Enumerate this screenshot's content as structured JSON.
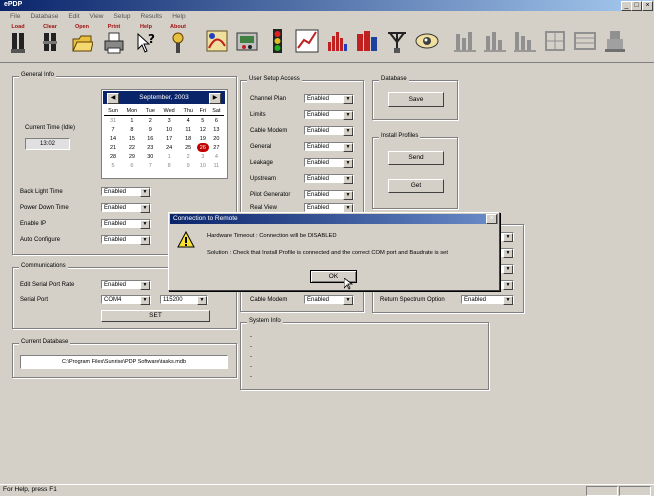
{
  "window": {
    "title": "ePDP",
    "controls": [
      "_",
      "□",
      "×"
    ]
  },
  "menu": [
    "File",
    "Database",
    "Edit",
    "View",
    "Setup",
    "Results",
    "Help"
  ],
  "toolbar": {
    "buttons": [
      {
        "label": "Load",
        "icon": "load-icon"
      },
      {
        "label": "Clear",
        "icon": "clear-icon"
      },
      {
        "label": "Open",
        "icon": "open-folder-icon"
      },
      {
        "label": "Print",
        "icon": "printer-icon"
      },
      {
        "label": "Help",
        "icon": "help-cursor-icon"
      },
      {
        "label": "About",
        "icon": "about-icon"
      }
    ],
    "icons": [
      "wire-tools-icon",
      "meter-icon",
      "traffic-light-icon",
      "graph-icon",
      "histogram-icon",
      "bar-chart-icon",
      "antenna-icon",
      "eye-icon",
      "grey-chart-1-icon",
      "grey-chart-2-icon",
      "grey-chart-3-icon",
      "grey-chart-4-icon",
      "grey-chart-5-icon",
      "grey-chart-6-icon"
    ]
  },
  "general": {
    "title": "General Info",
    "current_time_label": "Current Time (Idle)",
    "current_time_value": "13:02",
    "calendar": {
      "month": "September, 2003",
      "days": [
        "Sun",
        "Mon",
        "Tue",
        "Wed",
        "Thu",
        "Fri",
        "Sat"
      ],
      "weeks": [
        [
          "31",
          "1",
          "2",
          "3",
          "4",
          "5",
          "6"
        ],
        [
          "7",
          "8",
          "9",
          "10",
          "11",
          "12",
          "13"
        ],
        [
          "14",
          "15",
          "16",
          "17",
          "18",
          "19",
          "20"
        ],
        [
          "21",
          "22",
          "23",
          "24",
          "25",
          "26",
          "27"
        ],
        [
          "28",
          "29",
          "30",
          "1",
          "2",
          "3",
          "4"
        ],
        [
          "5",
          "6",
          "7",
          "8",
          "9",
          "10",
          "11"
        ]
      ],
      "selected": "26"
    },
    "settings": [
      {
        "label": "Back Light Time",
        "value": "Enabled"
      },
      {
        "label": "Power Down Time",
        "value": "Enabled"
      },
      {
        "label": "Enable IP",
        "value": "Enabled"
      },
      {
        "label": "Auto Configure",
        "value": "Enabled"
      }
    ]
  },
  "communications": {
    "title": "Communications",
    "serial_rate_label": "Edit Serial Port Rate",
    "serial_rate_value": "Enabled",
    "serial_port_label": "Serial Port",
    "serial_port_value": "COM4",
    "baud_value": "115200",
    "set_button": "SET"
  },
  "current_database": {
    "title": "Current Database",
    "path": "C:\\Program Files\\Sunrise\\PDP Software\\tasks.mdb"
  },
  "user_setup": {
    "title": "User Setup Access",
    "rows": [
      {
        "label": "Channel Plan",
        "value": "Enabled"
      },
      {
        "label": "Limits",
        "value": "Enabled"
      },
      {
        "label": "Cable Modem",
        "value": "Enabled"
      },
      {
        "label": "General",
        "value": "Enabled"
      },
      {
        "label": "Leakage",
        "value": "Enabled"
      },
      {
        "label": "Upstream",
        "value": "Enabled"
      },
      {
        "label": "Pilot Generator",
        "value": "Enabled"
      },
      {
        "label": "Real View",
        "value": "Enabled"
      }
    ],
    "cable_modem_label": "Cable Modem",
    "cable_modem_value": "Enabled"
  },
  "database_box": {
    "title": "Database",
    "save": "Save"
  },
  "install_profiles": {
    "title": "Install Profiles",
    "send": "Send",
    "get": "Get"
  },
  "return_spectrum": {
    "label": "Return Spectrum Option",
    "value": "Enabled"
  },
  "system_info": {
    "title": "System Info",
    "lines": [
      "-",
      "-",
      "-",
      "-",
      "-"
    ]
  },
  "dialog": {
    "title": "Connection to Remote",
    "line1": "Hardware Timeout : Connection will be DISABLED",
    "line2": "Solution : Check that Install Profile is connected and the correct COM port and Baudrate is set",
    "ok": "OK"
  },
  "status": {
    "text": "For Help, press F1"
  }
}
